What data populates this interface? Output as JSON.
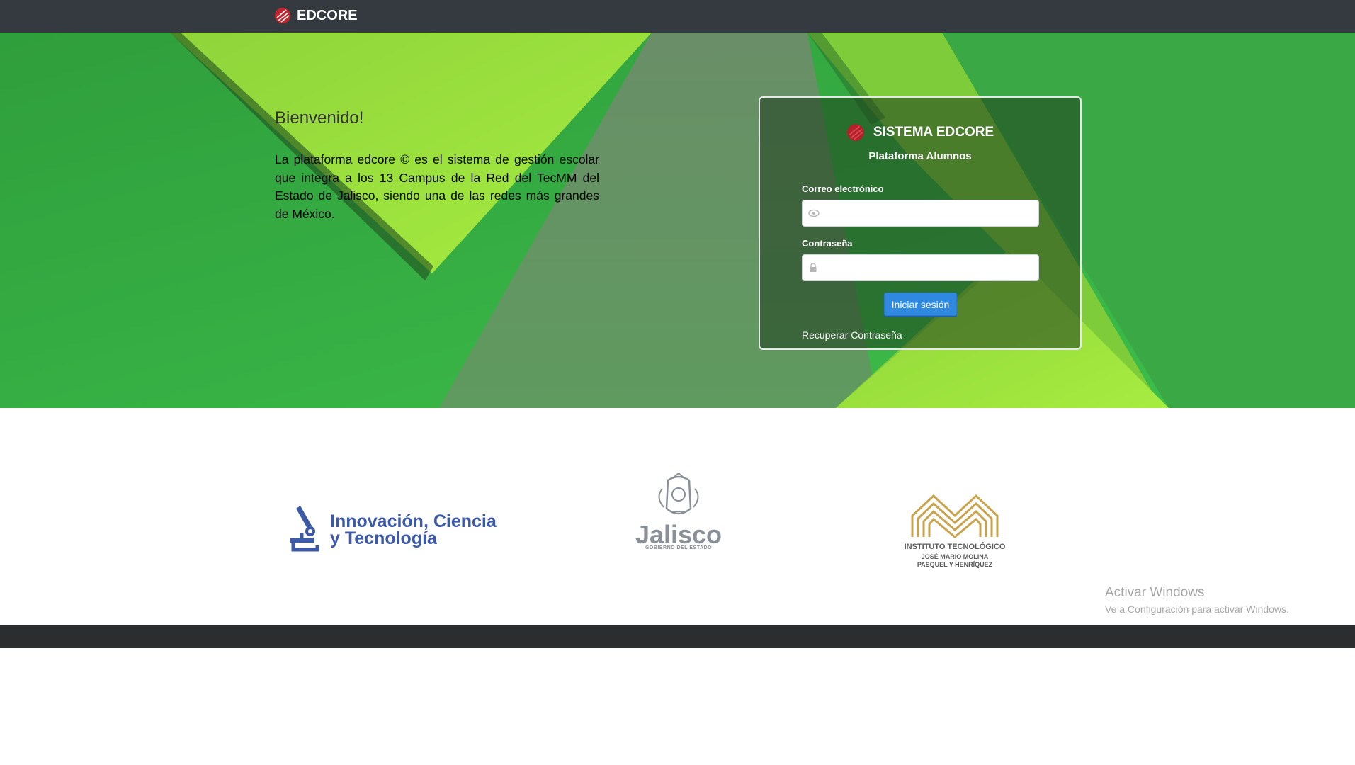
{
  "navbar": {
    "brand_label": "EDCORE"
  },
  "welcome": {
    "title": "Bienvenido!",
    "text": "La plataforma edcore © es el sistema de gestión escolar que integra a los 13 Campus de la Red del TecMM del Estado de Jalisco, siendo una de las redes más grandes de México."
  },
  "login": {
    "title": "SISTEMA EDCORE",
    "subtitle": "Plataforma Alumnos",
    "email_label": "Correo electrónico",
    "email_value": "",
    "password_label": "Contraseña",
    "password_value": "",
    "submit_label": "Iniciar sesión",
    "recover_label": "Recuperar Contraseña"
  },
  "logos": {
    "ict_line1": "Innovación, Ciencia",
    "ict_line2": "y Tecnología",
    "jalisco_name": "Jalisco",
    "jalisco_sub": "GOBIERNO DEL ESTADO",
    "itj_line1": "INSTITUTO TECNOLÓGICO",
    "itj_line2": "JOSÉ MARIO MOLINA",
    "itj_line3": "PASQUEL Y HENRÍQUEZ"
  },
  "watermark": {
    "line1": "Activar Windows",
    "line2": "Ve a Configuración para activar Windows."
  },
  "colors": {
    "navbar": "#343a40",
    "footer": "#2b2d2f",
    "button": "#2f89e0",
    "ict_blue": "#3d5aa8",
    "itj_gold": "#c9a24a"
  },
  "icons": {
    "brand": "edcore-logo-icon",
    "email_field": "eye-icon",
    "password_field": "lock-icon"
  }
}
